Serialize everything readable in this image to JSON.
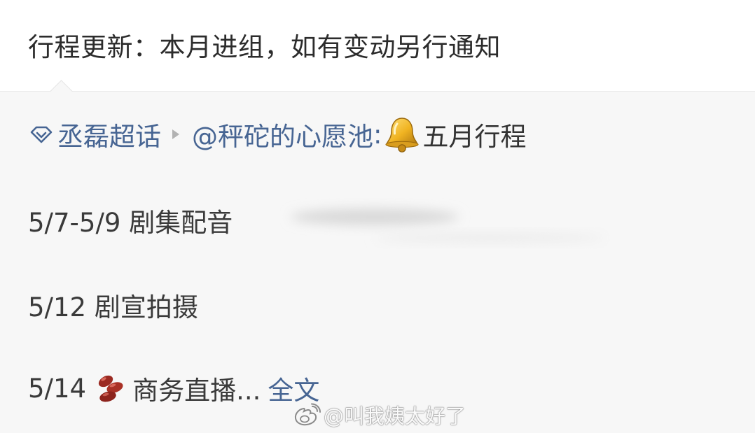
{
  "post": {
    "text": "行程更新：本月进组，如有变动另行通知"
  },
  "quote": {
    "topic_name": "丞磊超话",
    "mention": "@秤砣的心愿池",
    "colon": ":",
    "topic_tail": "五月行程",
    "lines": [
      {
        "text": "5/7-5/9 剧集配音"
      },
      {
        "text": "5/12 剧宣拍摄"
      },
      {
        "date": "5/14",
        "text": "商务直播...",
        "link": "全文"
      }
    ]
  },
  "watermark": {
    "text": "@叫我姨太好了"
  },
  "icons": {
    "topic": "diamond-topic-icon",
    "crumb": "triangle-arrow-icon",
    "bell": "bell-emoji-icon",
    "bean": "bean-emoji-icon",
    "watermark_logo": "weibo-logo-icon"
  },
  "colors": {
    "link": "#476593",
    "quote_bg": "#f7f7f7",
    "text": "#2c2c2c"
  }
}
